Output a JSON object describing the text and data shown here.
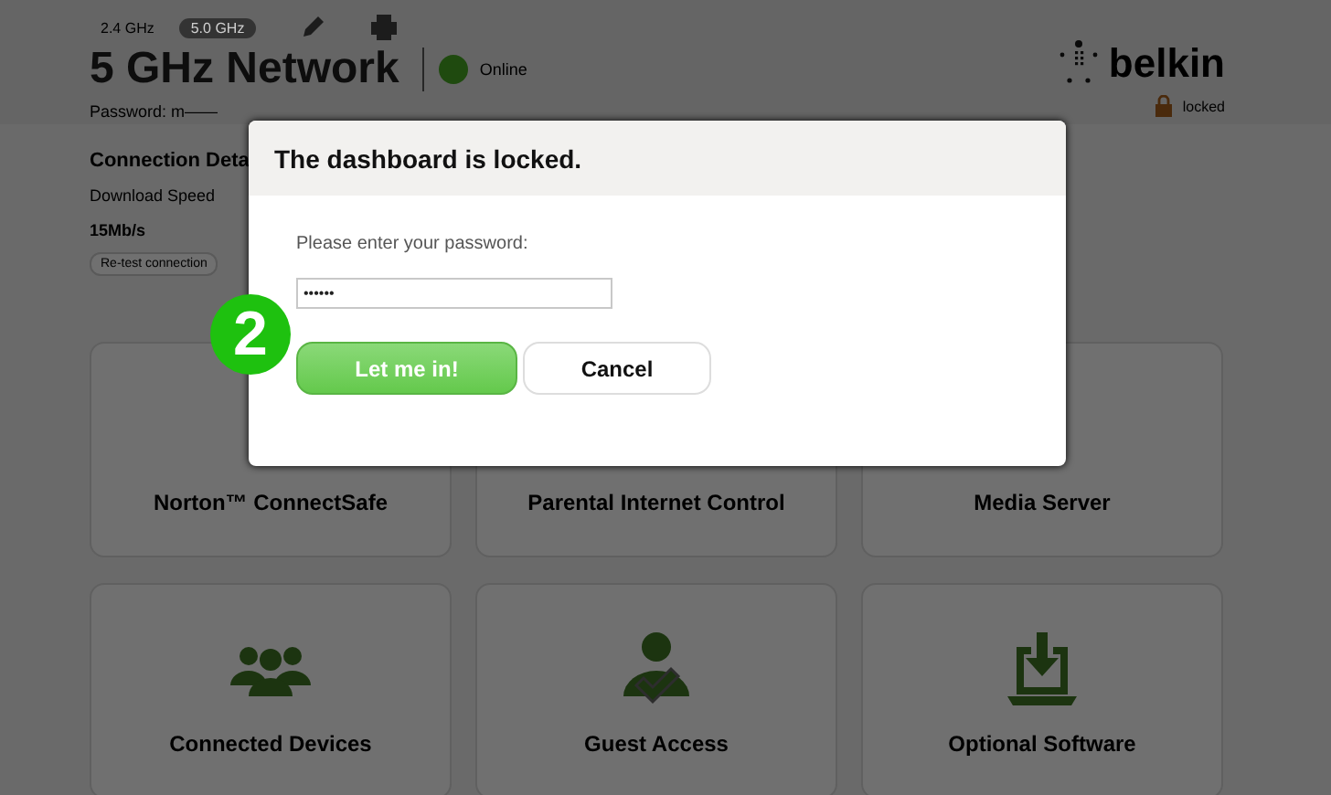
{
  "bands": [
    {
      "label": "2.4 GHz",
      "selected": false
    },
    {
      "label": "5.0 GHz",
      "selected": true
    }
  ],
  "network": {
    "title": "5 GHz Network",
    "status": "Online",
    "online": true,
    "password": "Password: m——"
  },
  "logo": "belkin",
  "lock": {
    "label": "locked"
  },
  "connection": {
    "title": "Connection Deta",
    "speed_label": "Download Speed",
    "speed": "15Mb/s",
    "retest": "Re-test connection"
  },
  "tiles": [
    {
      "label": "Norton™ ConnectSafe",
      "kind": "none"
    },
    {
      "label": "Parental Internet Control",
      "kind": "none"
    },
    {
      "label": "Media Server",
      "kind": "none"
    },
    {
      "label": "Connected Devices",
      "kind": "people"
    },
    {
      "label": "Guest Access",
      "kind": "guest"
    },
    {
      "label": "Optional Software",
      "kind": "download"
    }
  ],
  "dialog": {
    "title": "The dashboard is locked.",
    "prompt": "Please enter your password:",
    "password": "••••••",
    "buttons": [
      {
        "label": "Let me in!",
        "kind": "primary"
      },
      {
        "label": "Cancel",
        "kind": "secondary"
      }
    ]
  },
  "step": "2"
}
